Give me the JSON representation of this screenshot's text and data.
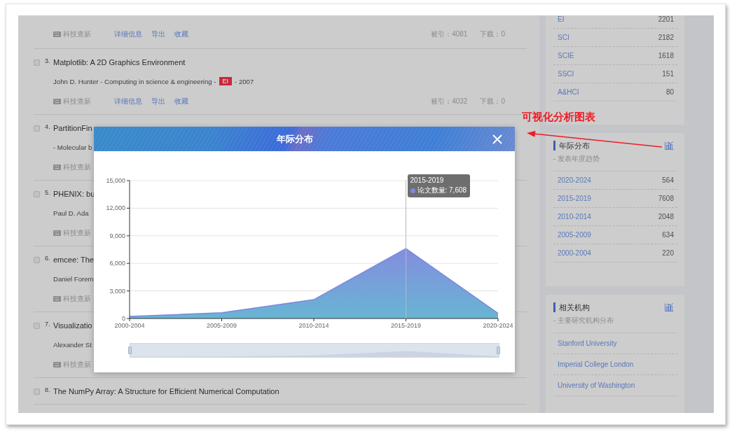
{
  "results": {
    "items": [
      {
        "tool": "科技查新",
        "actions": [
          "详细信息",
          "导出",
          "收藏"
        ],
        "citations": "被引：4081",
        "downloads": "下载：0"
      },
      {
        "checked": false,
        "number": "3.",
        "title": "Matplotlib: A 2D Graphics Environment",
        "authors": "John D. Hunter - Computing in science & engineering -",
        "badge": "EI",
        "year": "- 2007",
        "tool": "科技查新",
        "actions": [
          "详细信息",
          "导出",
          "收藏"
        ],
        "citations": "被引：4032",
        "downloads": "下载：0"
      },
      {
        "checked": false,
        "number": "4.",
        "title": "PartitionFin",
        "authors": "- Molecular b",
        "tool": "科技查新"
      },
      {
        "checked": false,
        "number": "5.",
        "title": "PHENIX: bu",
        "authors": "Paul D. Ada",
        "tool": "科技查新"
      },
      {
        "checked": false,
        "number": "6.",
        "title": "emcee: The",
        "authors": "Daniel Forem",
        "tool": "科技查新"
      },
      {
        "checked": false,
        "number": "7.",
        "title": "Visualizatio",
        "authors": "Alexander St",
        "tool": "科技查新"
      },
      {
        "checked": false,
        "number": "8.",
        "title": "The NumPy Array: A Structure for Efficient Numerical Computation"
      }
    ]
  },
  "sidebar": {
    "cards": [
      {
        "kind": "counts",
        "rows": [
          {
            "label": "EI",
            "count": "2201"
          },
          {
            "label": "SCI",
            "count": "2182"
          },
          {
            "label": "SCIE",
            "count": "1618"
          },
          {
            "label": "SSCI",
            "count": "151"
          },
          {
            "label": "A&HCI",
            "count": "80"
          }
        ]
      },
      {
        "kind": "counts",
        "title": "年际分布",
        "subtitle": "- 发表年度趋势",
        "rows": [
          {
            "label": "2020-2024",
            "count": "564"
          },
          {
            "label": "2015-2019",
            "count": "7608"
          },
          {
            "label": "2010-2014",
            "count": "2048"
          },
          {
            "label": "2005-2009",
            "count": "634"
          },
          {
            "label": "2000-2004",
            "count": "220"
          }
        ]
      },
      {
        "kind": "links",
        "title": "相关机构",
        "subtitle": "- 主要研究机构分布",
        "rows": [
          {
            "label": "Stanford University"
          },
          {
            "label": "Imperial College London"
          },
          {
            "label": "University of Washington"
          }
        ]
      }
    ]
  },
  "modal": {
    "title": "年际分布",
    "chart_data": {
      "type": "area",
      "grid": true,
      "categories": [
        "2000-2004",
        "2005-2009",
        "2010-2014",
        "2015-2019",
        "2020-2024"
      ],
      "series": [
        {
          "color": "#7d88dc",
          "values": [
            220,
            634,
            2048,
            7608,
            564
          ]
        }
      ],
      "ylim": [
        0,
        15000
      ],
      "yticks": [
        {
          "value": 0,
          "label": "0"
        },
        {
          "value": 3000,
          "label": "3,000"
        },
        {
          "value": 6000,
          "label": "6,000"
        },
        {
          "value": 9000,
          "label": "9,000"
        },
        {
          "value": 12000,
          "label": "12,000"
        },
        {
          "value": 15000,
          "label": "15,000"
        }
      ],
      "ref_lines": [
        {
          "axis": "x",
          "value": "2015-2019"
        }
      ]
    },
    "tooltip": {
      "title": "2015-2019",
      "text": "论文数量: 7,608"
    },
    "zoom": {
      "level": 1
    }
  },
  "annotation": {
    "text": "可视化分析图表"
  }
}
